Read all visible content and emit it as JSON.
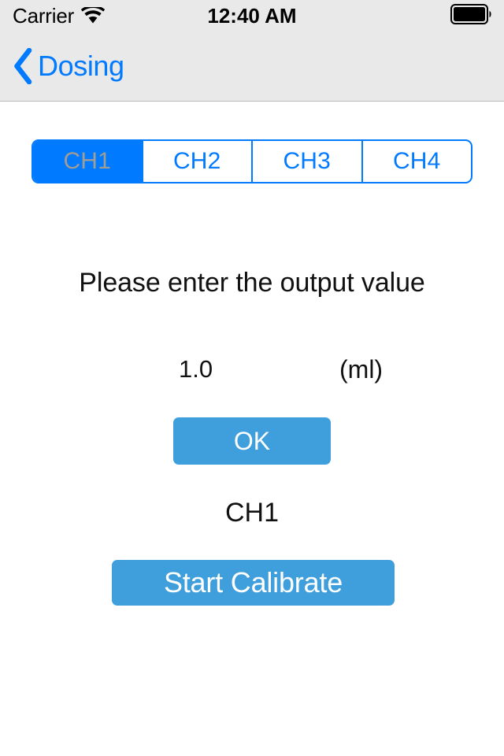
{
  "status_bar": {
    "carrier": "Carrier",
    "wifi_icon": "wifi-icon",
    "time": "12:40 AM",
    "battery_icon": "battery-full-icon"
  },
  "nav_bar": {
    "back_icon": "chevron-left-icon",
    "back_label": "Dosing"
  },
  "segmented_control": {
    "selected_index": 0,
    "segments": [
      {
        "label": "CH1"
      },
      {
        "label": "CH2"
      },
      {
        "label": "CH3"
      },
      {
        "label": "CH4"
      }
    ]
  },
  "main": {
    "prompt": "Please enter the output value",
    "value_input": {
      "value": "1.0",
      "placeholder": "1.0"
    },
    "unit_label": "(ml)",
    "ok_label": "OK",
    "channel_status": "CH1",
    "start_calibrate_label": "Start Calibrate"
  },
  "colors": {
    "tint_blue": "#007aff",
    "button_blue": "#3f9fdc",
    "bar_gray": "#e9e9e9",
    "bg_top": "#a29e97",
    "bg_bottom": "#dcc79e",
    "text_black": "#111111",
    "selected_segment_text": "#a09d96"
  }
}
